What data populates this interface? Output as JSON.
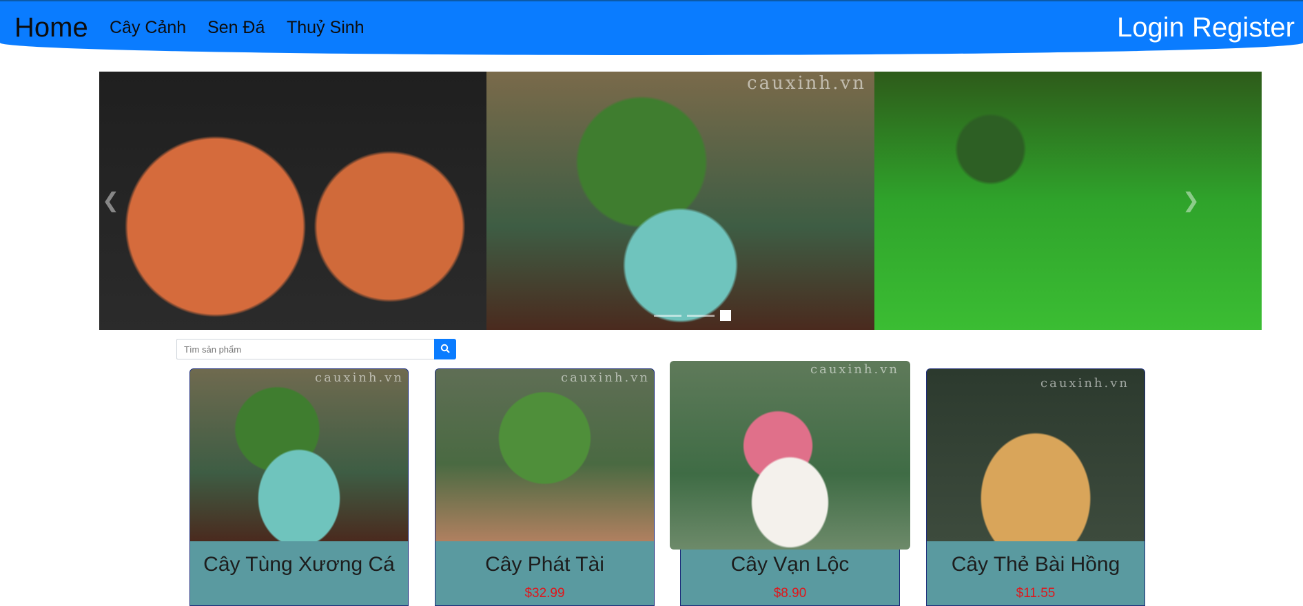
{
  "nav": {
    "home": "Home",
    "links": [
      "Cây Cảnh",
      "Sen Đá",
      "Thuỷ Sinh"
    ],
    "login": "Login",
    "register": "Register"
  },
  "carousel": {
    "watermark": "cauxinh.vn",
    "prev_icon": "chevron-left-icon",
    "next_icon": "chevron-right-icon"
  },
  "search": {
    "placeholder": "Tìm sản phẩm",
    "button_icon": "search-icon"
  },
  "products": [
    {
      "name": "Cây Tùng Xương Cá",
      "price": "",
      "watermark": "cauxinh.vn"
    },
    {
      "name": "Cây Phát Tài",
      "price": "$32.99",
      "watermark": "cauxinh.vn"
    },
    {
      "name": "Cây Vạn Lộc",
      "price": "$8.90",
      "watermark": "cauxinh.vn"
    },
    {
      "name": "Cây Thẻ Bài Hồng",
      "price": "$11.55",
      "watermark": "cauxinh.vn"
    }
  ],
  "colors": {
    "navbar": "#0a7cff",
    "card_body": "#5a9aa0",
    "price": "#e0161b"
  }
}
